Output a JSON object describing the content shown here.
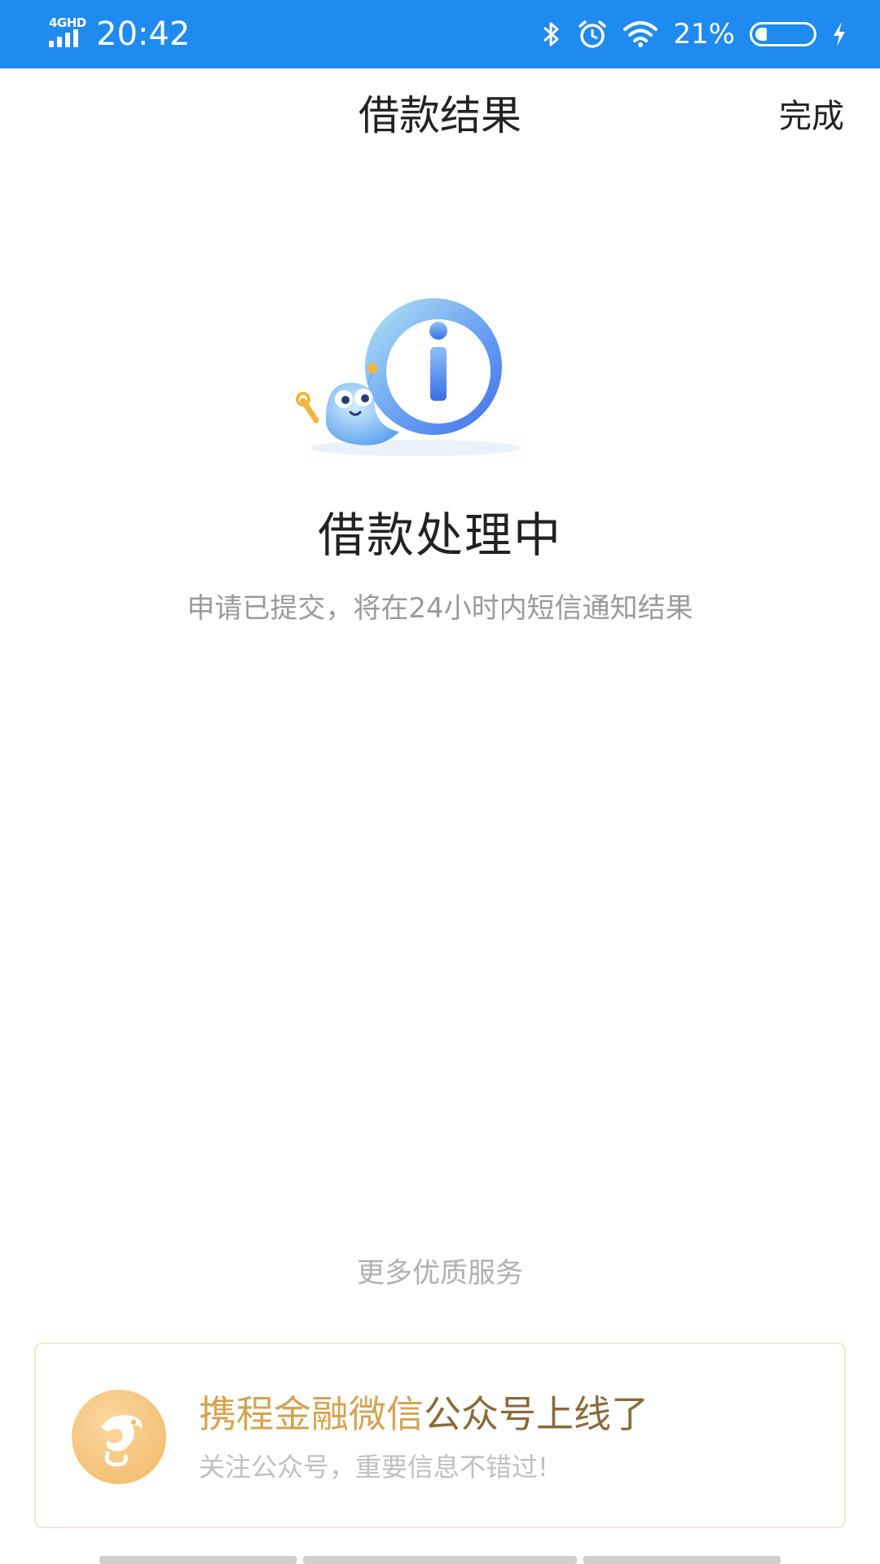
{
  "status_bar": {
    "network": "4GHD",
    "time": "20:42",
    "battery_percent": "21%",
    "battery_level": 0.21,
    "icons": [
      "signal-icon",
      "bluetooth-icon",
      "alarm-icon",
      "wifi-icon",
      "battery-icon",
      "charging-icon"
    ]
  },
  "nav": {
    "title": "借款结果",
    "done_label": "完成"
  },
  "result": {
    "icon": "info-mascot-icon",
    "title": "借款处理中",
    "description": "申请已提交，将在24小时内短信通知结果"
  },
  "services": {
    "section_label": "更多优质服务",
    "promo": {
      "title_highlight": "携程金融微信",
      "title_rest": "公众号上线了",
      "subtitle": "关注公众号，重要信息不错过!",
      "logo_icon": "dolphin-logo-icon"
    }
  },
  "colors": {
    "status_bar": "#1f8af0",
    "promo_highlight": "#d3a452",
    "promo_text": "#8a6a3a",
    "info_blue": "#4a8cf0"
  }
}
